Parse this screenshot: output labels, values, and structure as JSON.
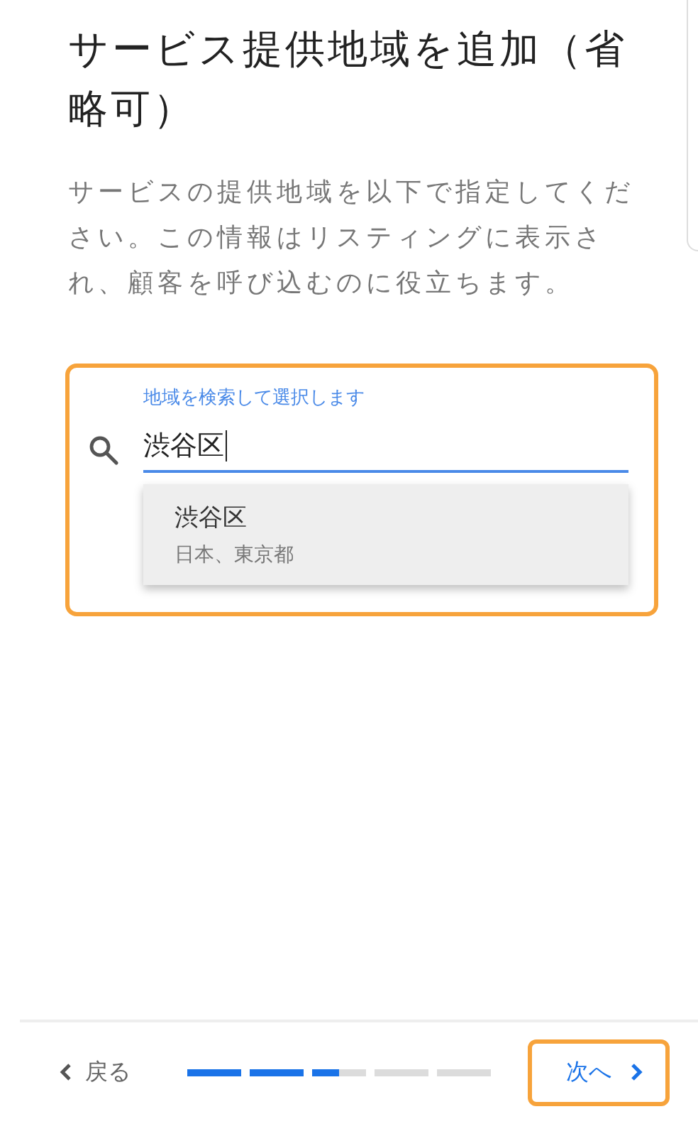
{
  "title": "サービス提供地域を追加（省略可）",
  "description": "サービスの提供地域を以下で指定してください。この情報はリスティングに表示され、顧客を呼び込むのに役立ちます。",
  "search": {
    "label": "地域を検索して選択します",
    "value": "渋谷区",
    "highlighted": true,
    "suggestions": [
      {
        "name": "渋谷区",
        "detail": "日本、東京都"
      }
    ]
  },
  "footer": {
    "back": "戻る",
    "next": {
      "label": "次へ",
      "highlighted": true
    },
    "progress": {
      "level": 0.5
    }
  }
}
